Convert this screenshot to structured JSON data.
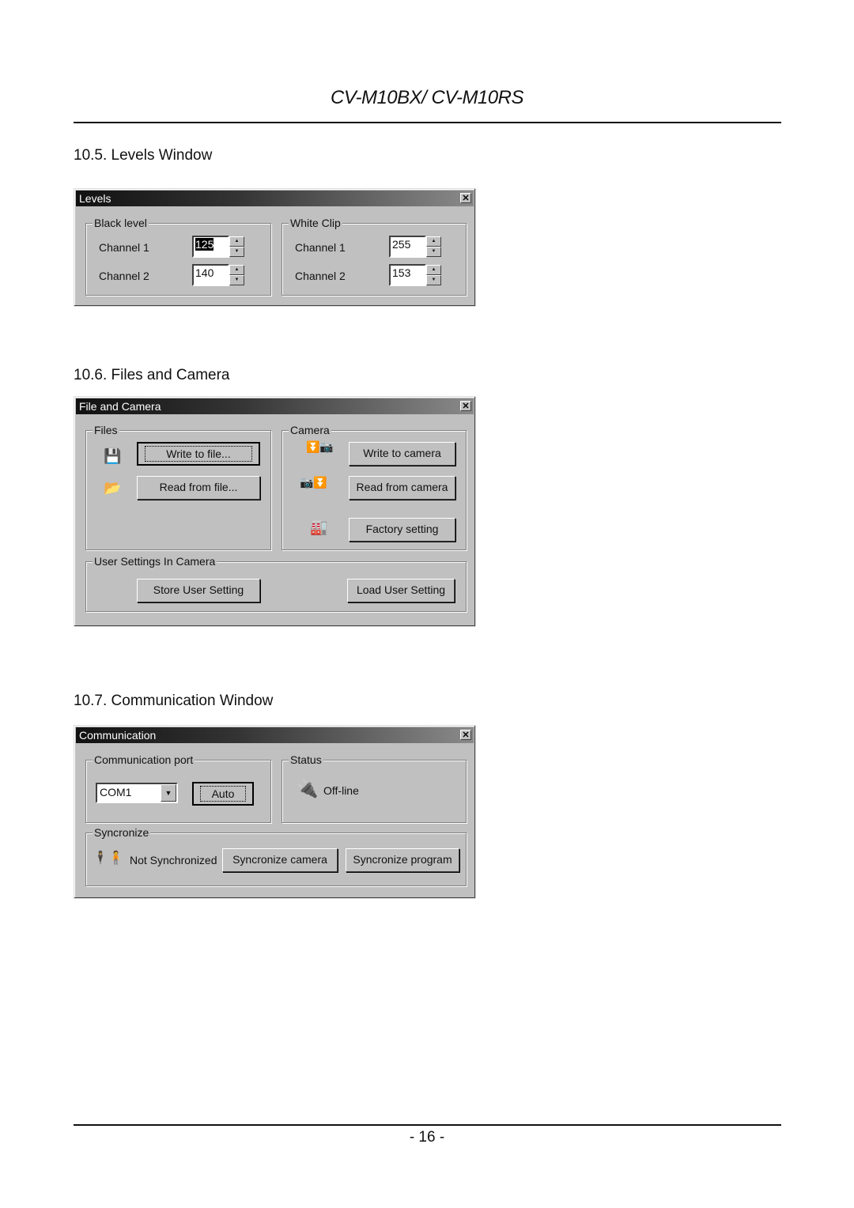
{
  "document": {
    "header": "CV-M10BX/ CV-M10RS",
    "page_number": "- 16 -"
  },
  "levels": {
    "section_title": "10.5. Levels Window",
    "window_title": "Levels",
    "close_glyph": "✕",
    "black_level": {
      "label": "Black level",
      "channel1_label": "Channel 1",
      "channel1_value": "125",
      "channel2_label": "Channel 2",
      "channel2_value": "140"
    },
    "white_clip": {
      "label": "White Clip",
      "channel1_label": "Channel 1",
      "channel1_value": "255",
      "channel2_label": "Channel 2",
      "channel2_value": "153"
    },
    "spin_up_glyph": "▲",
    "spin_down_glyph": "▼"
  },
  "file_camera": {
    "section_title": "10.6. Files and Camera",
    "window_title": "File and Camera",
    "close_glyph": "✕",
    "files": {
      "label": "Files",
      "write_button": "Write to file...",
      "read_button": "Read from file...",
      "write_icon": "floppy-disk-icon",
      "read_icon": "open-folder-icon"
    },
    "camera": {
      "label": "Camera",
      "write_button": "Write to camera",
      "read_button": "Read from camera",
      "factory_button": "Factory setting",
      "write_icon": "download-to-camera-icon",
      "read_icon": "upload-from-camera-icon",
      "factory_icon": "factory-icon"
    },
    "user_settings": {
      "label": "User Settings In Camera",
      "store_button": "Store User Setting",
      "load_button": "Load User Setting"
    }
  },
  "communication": {
    "section_title": "10.7. Communication Window",
    "window_title": "Communication",
    "close_glyph": "✕",
    "port": {
      "label": "Communication port",
      "selected": "COM1",
      "auto_button": "Auto",
      "dropdown_glyph": "▼"
    },
    "status": {
      "label": "Status",
      "value": "Off-line",
      "icon": "connector-plug-icon"
    },
    "sync": {
      "label": "Syncronize",
      "status_text": "Not Synchronized",
      "camera_button": "Syncronize camera",
      "program_button": "Syncronize program"
    }
  }
}
